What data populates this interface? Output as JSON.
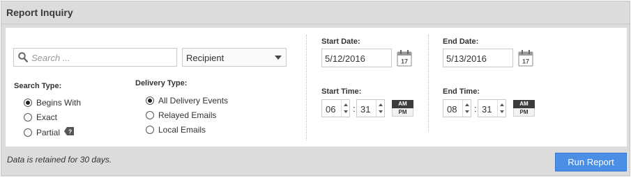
{
  "header": {
    "title": "Report Inquiry"
  },
  "search": {
    "placeholder": "Search ..."
  },
  "recipient_select": {
    "value": "Recipient"
  },
  "search_type": {
    "label": "Search Type:",
    "options": [
      "Begins With",
      "Exact",
      "Partial"
    ],
    "selected": "Begins With"
  },
  "delivery_type": {
    "label": "Delivery Type:",
    "options": [
      "All Delivery Events",
      "Relayed Emails",
      "Local Emails"
    ],
    "selected": "All Delivery Events"
  },
  "start": {
    "date_label": "Start Date:",
    "date_value": "5/12/2016",
    "time_label": "Start Time:",
    "hour": "06",
    "minute": "31"
  },
  "end": {
    "date_label": "End Date:",
    "date_value": "5/13/2016",
    "time_label": "End Time:",
    "hour": "08",
    "minute": "31"
  },
  "calendar_day": "17",
  "time_separator": ":",
  "ampm": {
    "am": "AM",
    "pm": "PM",
    "selected": "AM"
  },
  "footer": {
    "note": "Data is retained for 30 days.",
    "run_button": "Run Report"
  },
  "colors": {
    "accent": "#4a8ee6",
    "panel_bg": "#dcdcdc"
  }
}
